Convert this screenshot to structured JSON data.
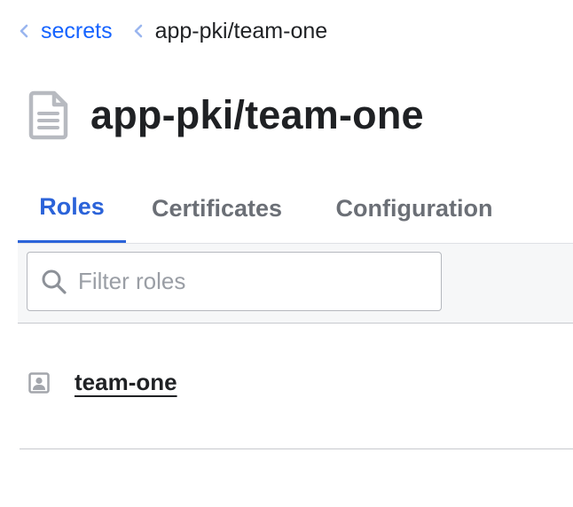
{
  "breadcrumb": {
    "items": [
      {
        "label": "secrets",
        "link": true
      },
      {
        "label": "app-pki/team-one",
        "link": false
      }
    ]
  },
  "header": {
    "title": "app-pki/team-one",
    "icon": "document-icon"
  },
  "tabs": [
    {
      "label": "Roles",
      "active": true
    },
    {
      "label": "Certificates",
      "active": false
    },
    {
      "label": "Configuration",
      "active": false
    }
  ],
  "toolbar": {
    "search": {
      "placeholder": "Filter roles",
      "value": ""
    }
  },
  "roles": {
    "items": [
      {
        "label": "team-one",
        "icon": "user-icon"
      }
    ]
  },
  "colors": {
    "accent": "#2b63d9",
    "link": "#1563ff",
    "text": "#1f2124",
    "muted": "#6b6f76"
  }
}
